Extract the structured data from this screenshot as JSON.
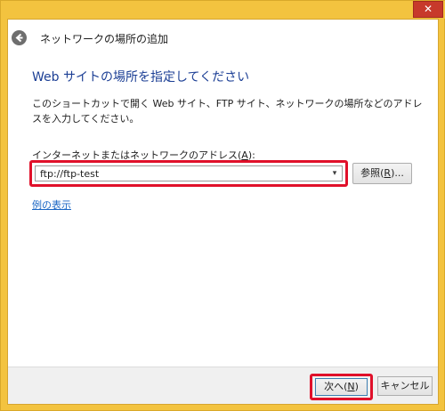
{
  "window": {
    "close_glyph": "✕"
  },
  "header": {
    "back_icon": "back-arrow-icon",
    "title": "ネットワークの場所の追加"
  },
  "main": {
    "heading": "Web サイトの場所を指定してください",
    "description": "このショートカットで開く Web サイト、FTP サイト、ネットワークの場所などのアドレスを入力してください。",
    "field_label_prefix": "インターネットまたはネットワークのアドレス(",
    "field_label_key": "A",
    "field_label_suffix": "):",
    "address_value": "ftp://ftp-test",
    "browse_prefix": "参照(",
    "browse_key": "R",
    "browse_suffix": ")...",
    "example_link": "例の表示"
  },
  "footer": {
    "next_prefix": "次へ(",
    "next_key": "N",
    "next_suffix": ")",
    "cancel_label": "キャンセル"
  },
  "colors": {
    "title_bar": "#f3c33f",
    "close_button": "#c7392b",
    "heading": "#1c3f95",
    "link": "#1a66c4",
    "highlight": "#e0102a"
  }
}
